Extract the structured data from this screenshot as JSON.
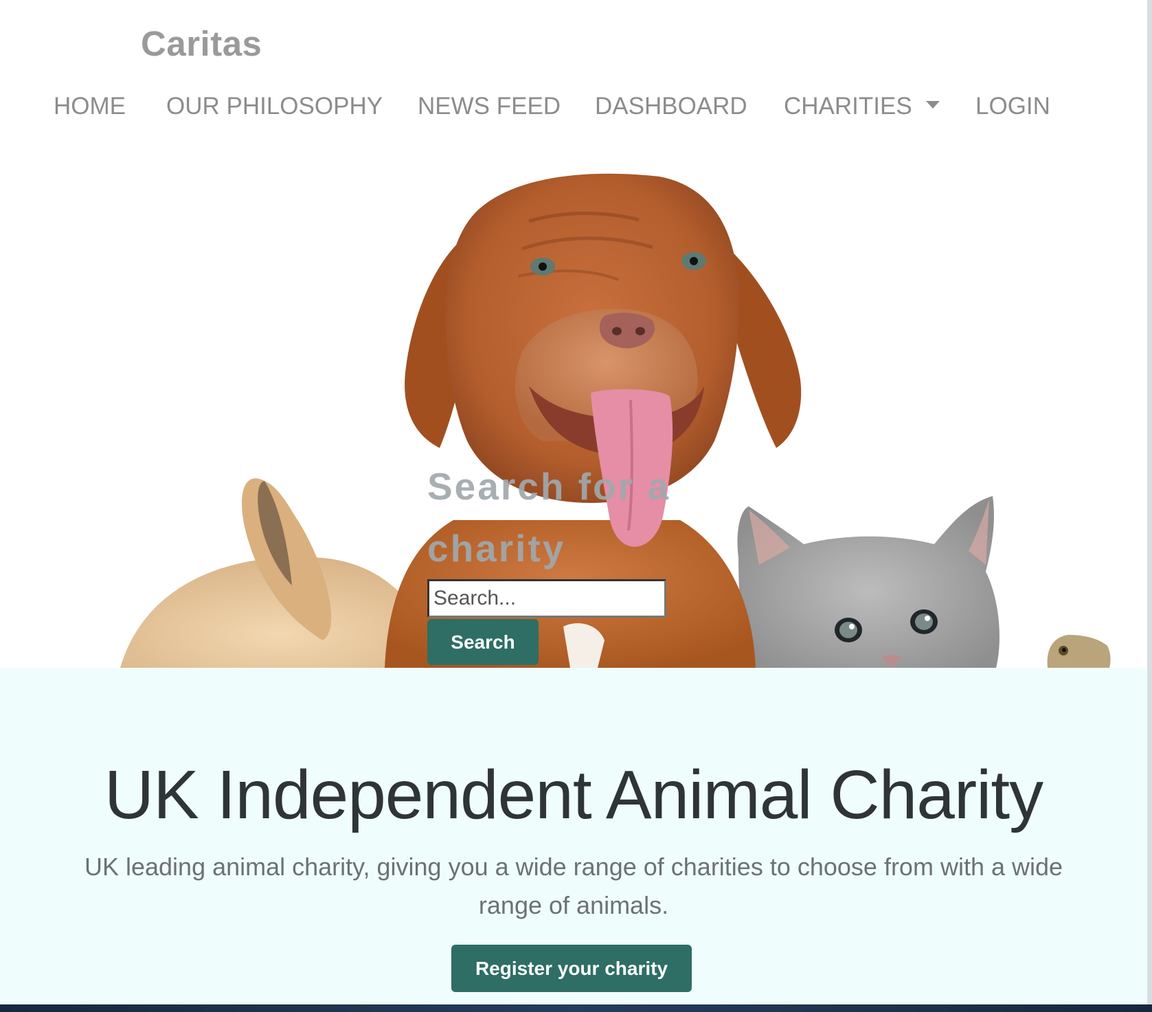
{
  "brand": {
    "name": "Caritas"
  },
  "nav": {
    "items": [
      {
        "label": "HOME"
      },
      {
        "label": "OUR PHILOSOPHY"
      },
      {
        "label": "NEWS FEED"
      },
      {
        "label": "DASHBOARD"
      },
      {
        "label": "CHARITIES"
      },
      {
        "label": "LOGIN"
      }
    ]
  },
  "hero": {
    "search_heading": "Search for a charity",
    "search_placeholder": "Search...",
    "search_value": "",
    "search_button": "Search"
  },
  "intro": {
    "title": "UK Independent Animal Charity",
    "text": "UK leading animal charity, giving you a wide range of charities to choose from with a wide range of animals.",
    "register_button": "Register your charity"
  },
  "colors": {
    "accent": "#2e6e64",
    "nav_text": "#8c8c8c",
    "intro_bg": "#f0fdfd",
    "title_text": "#2f3437"
  },
  "icons": {
    "dropdown": "caret-down-icon"
  }
}
